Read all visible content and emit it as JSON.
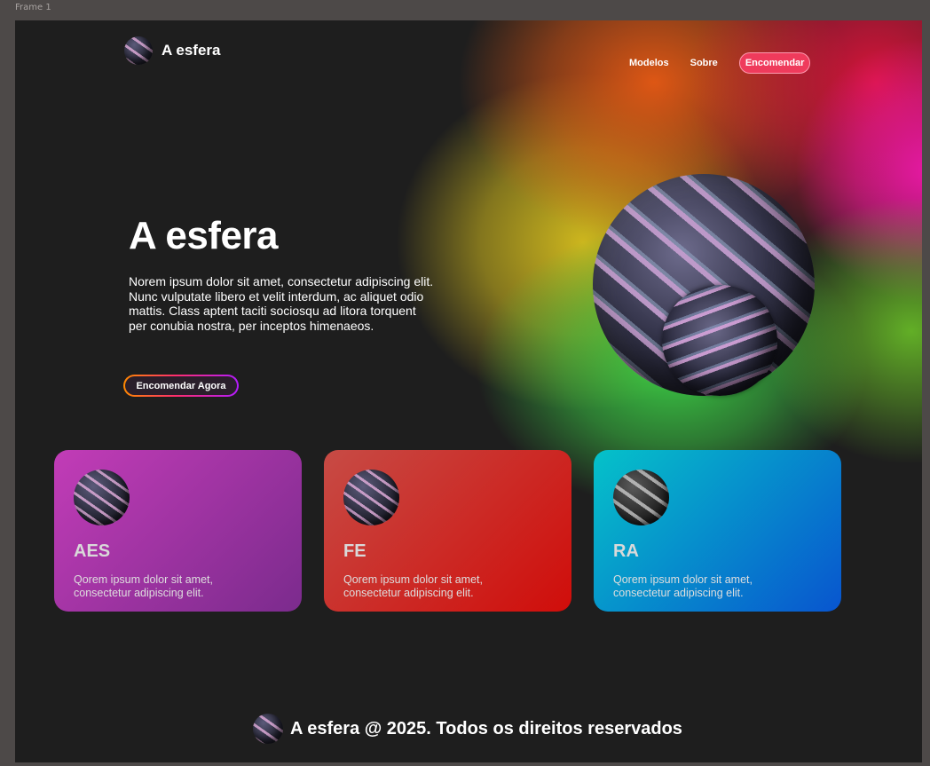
{
  "editor": {
    "frame_label": "Frame 1"
  },
  "header": {
    "brand": "A esfera",
    "nav": [
      {
        "label": "Modelos"
      },
      {
        "label": "Sobre"
      }
    ],
    "cta_label": "Encomendar"
  },
  "hero": {
    "title": "A esfera",
    "description": "Norem ipsum dolor sit amet, consectetur adipiscing elit. Nunc vulputate libero et velit interdum, ac aliquet odio mattis. Class aptent taciti sociosqu ad litora torquent per conubia nostra, per inceptos himenaeos.",
    "button_label": "Encomendar Agora"
  },
  "cards": [
    {
      "title": "AES",
      "text": "Qorem ipsum dolor sit amet, consectetur adipiscing elit.",
      "color_from": "#c23cb7",
      "color_to": "#7b2b8d"
    },
    {
      "title": "FE",
      "text": "Qorem ipsum dolor sit amet, consectetur adipiscing elit.",
      "color_from": "#c74b45",
      "color_to": "#d00d0a"
    },
    {
      "title": "RA",
      "text": "Qorem ipsum dolor sit amet, consectetur adipiscing elit.",
      "color_from": "#05c2c9",
      "color_to": "#0855cf"
    }
  ],
  "footer": {
    "text": "A esfera @ 2025. Todos os direitos reservados"
  },
  "colors": {
    "background": "#1e1e1e",
    "accent": "#ef3b5c"
  }
}
